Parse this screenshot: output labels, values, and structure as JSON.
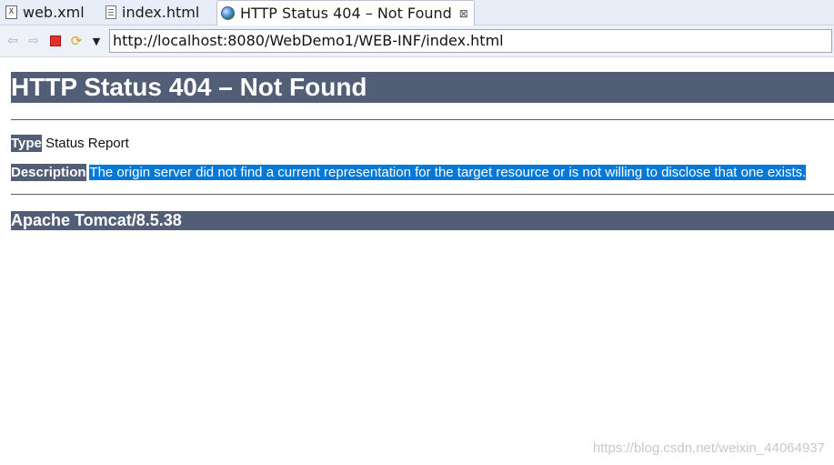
{
  "tabs": [
    {
      "label": "web.xml",
      "icon": "xml-file-icon",
      "active": false
    },
    {
      "label": "index.html",
      "icon": "html-file-icon",
      "active": false
    },
    {
      "label": "HTTP Status 404 – Not Found",
      "icon": "globe-icon",
      "active": true
    }
  ],
  "toolbar": {
    "url": "http://localhost:8080/WebDemo1/WEB-INF/index.html"
  },
  "page": {
    "title": "HTTP Status 404 – Not Found",
    "type_label": "Type",
    "type_value": "Status Report",
    "description_label": "Description",
    "description_value": "The origin server did not find a current representation for the target resource or is not willing to disclose that one exists.",
    "server": "Apache Tomcat/8.5.38"
  },
  "watermark": "https://blog.csdn.net/weixin_44064937",
  "colors": {
    "header_bg": "#525d76",
    "selection": "#0078d7"
  }
}
